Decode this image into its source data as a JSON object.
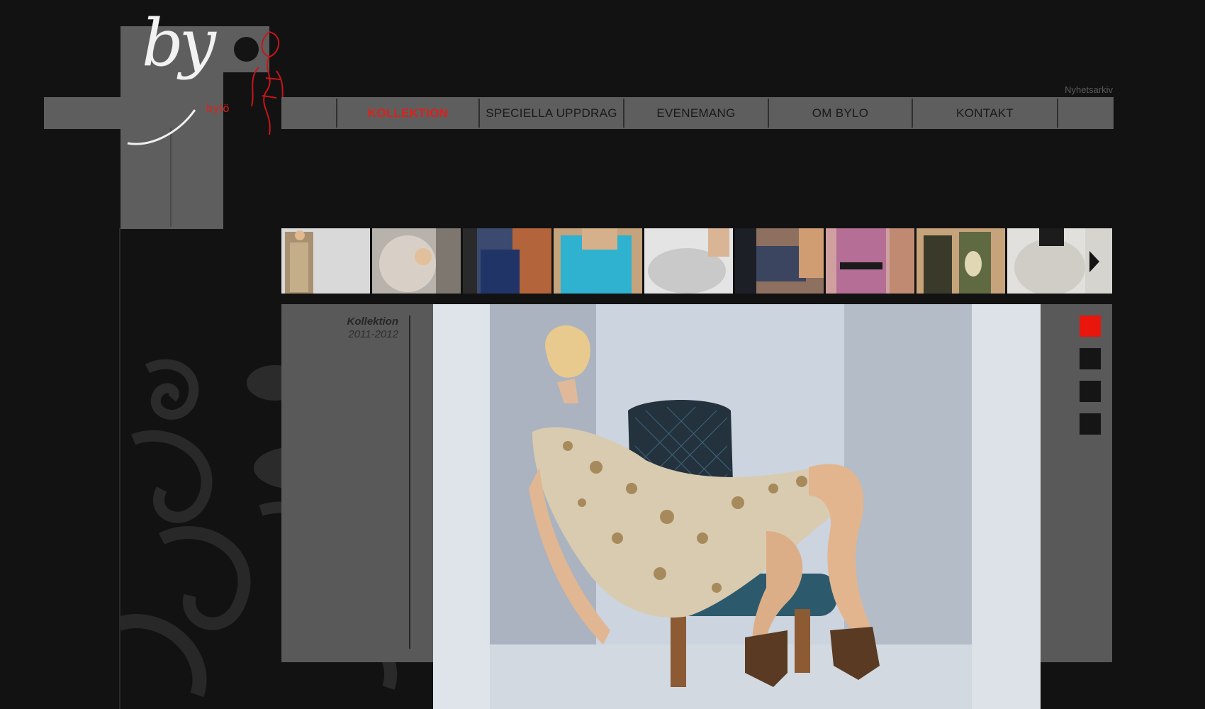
{
  "logo": {
    "script": "by",
    "sub": "bylö"
  },
  "nav": {
    "items": [
      {
        "label": "KOLLEKTION",
        "active": true
      },
      {
        "label": "SPECIELLA UPPDRAG",
        "active": false
      },
      {
        "label": "EVENEMANG",
        "active": false
      },
      {
        "label": "OM BYLO",
        "active": false
      },
      {
        "label": "KONTAKT",
        "active": false
      }
    ],
    "news_link": "Nyhetsarkiv"
  },
  "thumbnails": {
    "count": 9,
    "next_icon": "chevron-right-icon"
  },
  "collection": {
    "title": "Kollektion",
    "years": "2011-2012"
  },
  "slide_selector": {
    "count": 4,
    "active_index": 0
  },
  "colors": {
    "accent": "#e0201a",
    "panel": "#5e5e5e",
    "background": "#121212"
  }
}
